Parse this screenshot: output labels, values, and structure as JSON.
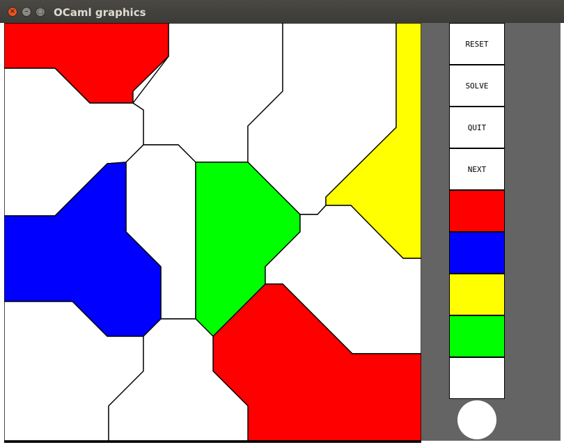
{
  "window": {
    "title": "OCaml graphics",
    "close_glyph": "×",
    "min_glyph": "–",
    "max_glyph": "□"
  },
  "colors": {
    "red": "#ff0000",
    "blue": "#0000ff",
    "yellow": "#ffff00",
    "green": "#00ff00",
    "white": "#ffffff",
    "panel": "#646464"
  },
  "panel": {
    "buttons": [
      {
        "label": "RESET"
      },
      {
        "label": "SOLVE"
      },
      {
        "label": "QUIT"
      },
      {
        "label": "NEXT"
      }
    ],
    "palette": [
      {
        "name": "red",
        "color": "#ff0000"
      },
      {
        "name": "blue",
        "color": "#0000ff"
      },
      {
        "name": "yellow",
        "color": "#ffff00"
      },
      {
        "name": "green",
        "color": "#00ff00"
      },
      {
        "name": "white",
        "color": "#ffffff"
      }
    ],
    "current_color": "#ffffff"
  },
  "map": {
    "regions": [
      {
        "name": "region-top-left",
        "color": "#ff0000"
      },
      {
        "name": "region-top-center",
        "color": "#ffffff"
      },
      {
        "name": "region-top-right",
        "color": "#ffffff"
      },
      {
        "name": "region-right-yellow",
        "color": "#ffff00"
      },
      {
        "name": "region-left-white",
        "color": "#ffffff"
      },
      {
        "name": "region-center-white",
        "color": "#ffffff"
      },
      {
        "name": "region-center-green",
        "color": "#00ff00"
      },
      {
        "name": "region-left-blue",
        "color": "#0000ff"
      },
      {
        "name": "region-right-white",
        "color": "#ffffff"
      },
      {
        "name": "region-bottom-red",
        "color": "#ff0000"
      },
      {
        "name": "region-bottom-left",
        "color": "#ffffff"
      },
      {
        "name": "region-bottom-center",
        "color": "#ffffff"
      }
    ]
  }
}
